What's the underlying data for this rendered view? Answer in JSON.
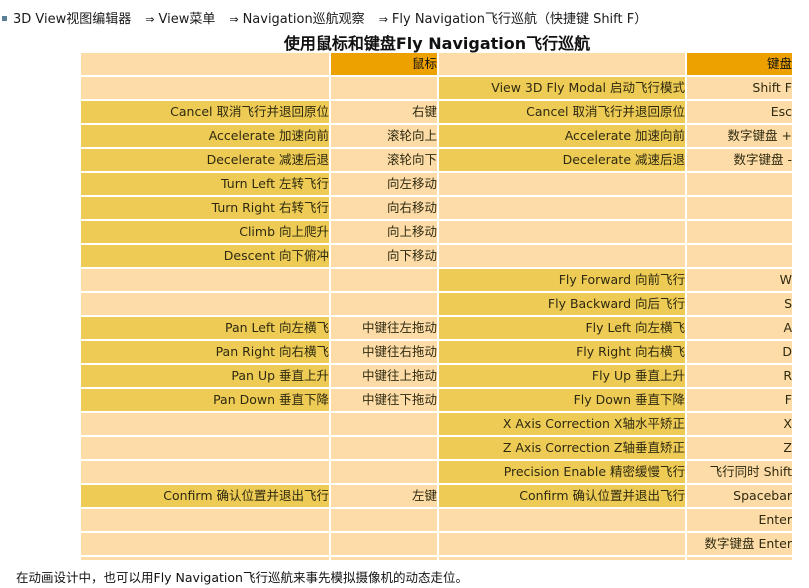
{
  "breadcrumb": [
    "3D View视图编辑器",
    "View菜单",
    "Navigation巡航观察",
    "Fly Navigation飞行巡航（快捷键 Shift F）"
  ],
  "breadcrumb_separator": "⇒",
  "title": "使用鼠标和键盘Fly Navigation飞行巡航",
  "table": {
    "headers": [
      "",
      "鼠标",
      "",
      "键盘"
    ],
    "rows": [
      [
        "",
        "",
        "View 3D Fly Modal 启动飞行模式",
        "Shift F"
      ],
      [
        "Cancel 取消飞行并退回原位",
        "右键",
        "Cancel 取消飞行并退回原位",
        "Esc"
      ],
      [
        "Accelerate 加速向前",
        "滚轮向上",
        "Accelerate 加速向前",
        "数字键盘 +"
      ],
      [
        "Decelerate 减速后退",
        "滚轮向下",
        "Decelerate 减速后退",
        "数字键盘 -"
      ],
      [
        "Turn Left 左转飞行",
        "向左移动",
        "",
        ""
      ],
      [
        "Turn Right 右转飞行",
        "向右移动",
        "",
        ""
      ],
      [
        "Climb 向上爬升",
        "向上移动",
        "",
        ""
      ],
      [
        "Descent 向下俯冲",
        "向下移动",
        "",
        ""
      ],
      [
        "",
        "",
        "Fly Forward 向前飞行",
        "W"
      ],
      [
        "",
        "",
        "Fly Backward 向后飞行",
        "S"
      ],
      [
        "Pan Left 向左横飞",
        "中键往左拖动",
        "Fly Left 向左横飞",
        "A"
      ],
      [
        "Pan Right 向右横飞",
        "中键往右拖动",
        "Fly Right 向右横飞",
        "D"
      ],
      [
        "Pan Up 垂直上升",
        "中键往上拖动",
        "Fly Up 垂直上升",
        "R"
      ],
      [
        "Pan Down 垂直下降",
        "中键往下拖动",
        "Fly Down 垂直下降",
        "F"
      ],
      [
        "",
        "",
        "X Axis Correction X轴水平矫正",
        "X"
      ],
      [
        "",
        "",
        "Z Axis Correction Z轴垂直矫正",
        "Z"
      ],
      [
        "",
        "",
        "Precision Enable 精密缓慢飞行",
        "飞行同时 Shift"
      ],
      [
        "Confirm 确认位置并退出飞行",
        "左键",
        "Confirm 确认位置并退出飞行",
        "Spacebar"
      ],
      [
        "",
        "",
        "",
        "Enter"
      ],
      [
        "",
        "",
        "",
        "数字键盘 Enter"
      ]
    ]
  },
  "footer": "在动画设计中，也可以用Fly Navigation飞行巡航来事先模拟摄像机的动态走位。",
  "colors": {
    "header": "#eda100",
    "action_filled": "#eecb55",
    "cell": "#fddca8"
  }
}
